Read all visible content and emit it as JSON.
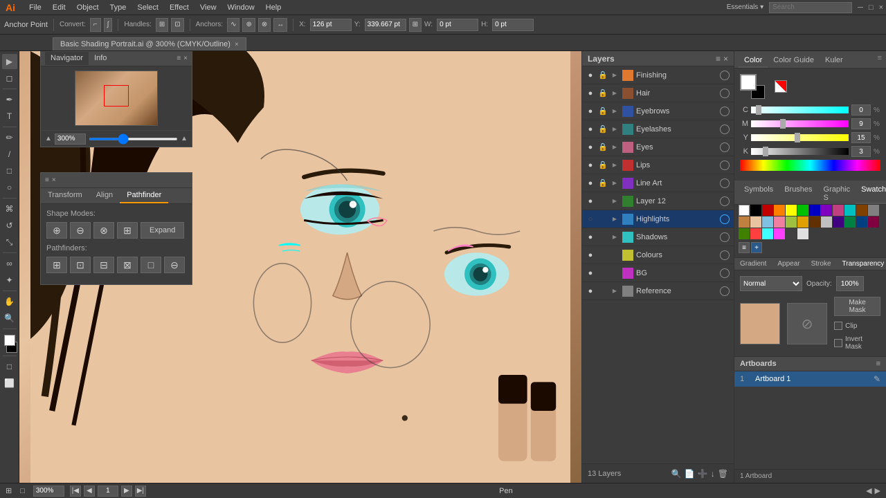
{
  "app": {
    "name": "Ai",
    "title": "Basic Shading Portrait.ai @ 300% (CMYK/Outline)"
  },
  "menubar": {
    "items": [
      "File",
      "Edit",
      "Object",
      "Type",
      "Select",
      "Effect",
      "View",
      "Window",
      "Help"
    ]
  },
  "toolbar": {
    "anchor_label": "Anchor Point",
    "convert_label": "Convert:",
    "handles_label": "Handles:",
    "anchors_label": "Anchors:",
    "x_label": "X:",
    "x_value": "126 pt",
    "y_label": "Y:",
    "y_value": "339.667 pt",
    "w_label": "W:",
    "w_value": "0 pt",
    "h_label": "H:",
    "h_value": "0 pt"
  },
  "doc_tab": {
    "title": "Basic Shading Portrait.ai @ 300% (CMYK/Outline)",
    "close": "×"
  },
  "layers": {
    "title": "Layers",
    "count": "13 Layers",
    "items": [
      {
        "name": "Finishing",
        "visible": true,
        "locked": true,
        "color": "lc-orange",
        "has_sub": true
      },
      {
        "name": "Hair",
        "visible": true,
        "locked": true,
        "color": "lc-brown",
        "has_sub": true
      },
      {
        "name": "Eyebrows",
        "visible": true,
        "locked": true,
        "color": "lc-darkblue",
        "has_sub": true
      },
      {
        "name": "Eyelashes",
        "visible": true,
        "locked": true,
        "color": "lc-teal",
        "has_sub": true
      },
      {
        "name": "Eyes",
        "visible": true,
        "locked": true,
        "color": "lc-pink",
        "has_sub": true
      },
      {
        "name": "Lips",
        "visible": true,
        "locked": true,
        "color": "lc-red",
        "has_sub": true
      },
      {
        "name": "Line Art",
        "visible": true,
        "locked": true,
        "color": "lc-purple",
        "has_sub": true
      },
      {
        "name": "Layer 12",
        "visible": true,
        "locked": false,
        "color": "lc-green",
        "has_sub": true
      },
      {
        "name": "Highlights",
        "visible": false,
        "locked": false,
        "color": "lc-blue",
        "has_sub": true,
        "active": true
      },
      {
        "name": "Shadows",
        "visible": true,
        "locked": false,
        "color": "lc-cyan",
        "has_sub": true
      },
      {
        "name": "Colours",
        "visible": true,
        "locked": false,
        "color": "lc-yellow",
        "has_sub": false
      },
      {
        "name": "BG",
        "visible": true,
        "locked": false,
        "color": "lc-magenta",
        "has_sub": false
      },
      {
        "name": "Reference",
        "visible": true,
        "locked": false,
        "color": "lc-gray",
        "has_sub": true
      }
    ]
  },
  "color_panel": {
    "tabs": [
      "Color",
      "Color Guide",
      "Kuler"
    ],
    "active_tab": "Color",
    "c_value": "0",
    "m_value": "9",
    "y_value": "15",
    "k_value": "3",
    "c_pos": "5",
    "m_pos": "30",
    "y_pos": "45",
    "k_pos": "12"
  },
  "swatches": {
    "tabs": [
      "Symbols",
      "Brushes",
      "Graphic S",
      "Swatches"
    ],
    "active_tab": "Swatches"
  },
  "appearance": {
    "tabs": [
      "Gradient",
      "Appear",
      "Stroke",
      "Transparency"
    ],
    "active_tab": "Transparency",
    "blend_mode": "Normal",
    "opacity": "100%",
    "make_mask_label": "Make Mask",
    "clip_label": "Clip",
    "invert_mask_label": "Invert Mask"
  },
  "artboards": {
    "title": "Artboards",
    "items": [
      {
        "num": "1",
        "name": "Artboard 1"
      }
    ],
    "count": "1 Artboard"
  },
  "navigator": {
    "tabs": [
      "Navigator",
      "Info"
    ],
    "active_tab": "Navigator",
    "zoom": "300%"
  },
  "pathfinder": {
    "tabs": [
      "Transform",
      "Align",
      "Pathfinder"
    ],
    "active_tab": "Pathfinder",
    "shape_modes_label": "Shape Modes:",
    "pathfinders_label": "Pathfinders:",
    "expand_label": "Expand"
  },
  "statusbar": {
    "zoom": "300%",
    "page": "1",
    "tool": "Pen"
  }
}
